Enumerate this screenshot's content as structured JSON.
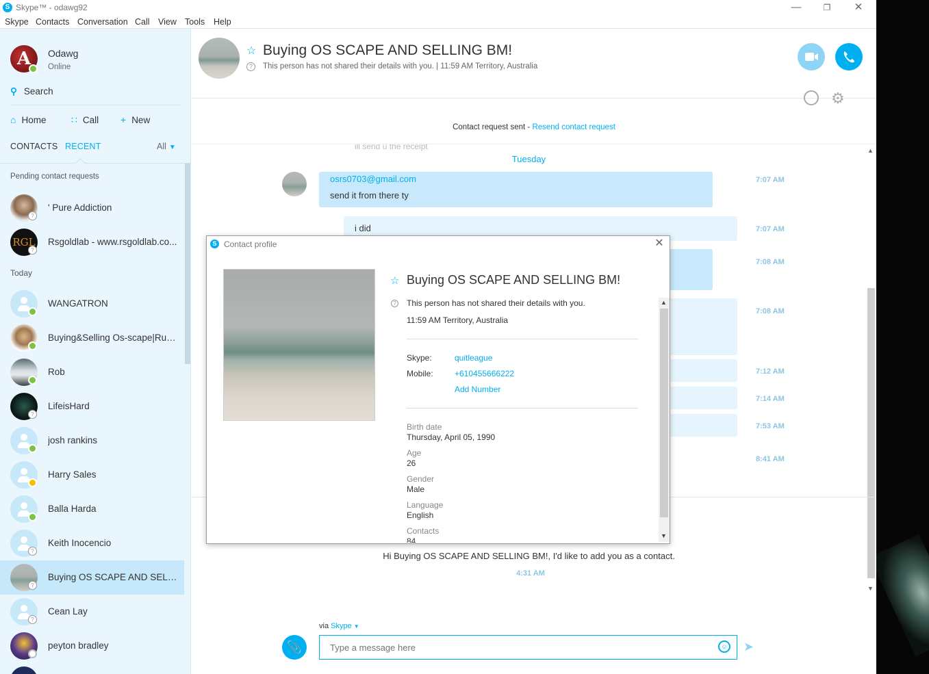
{
  "window": {
    "title": "Skype™ - odawg92",
    "logo": "S",
    "controls": {
      "minimize": "—",
      "restore": "❐",
      "close": "✕"
    }
  },
  "menu": [
    "Skype",
    "Contacts",
    "Conversation",
    "Call",
    "View",
    "Tools",
    "Help"
  ],
  "me": {
    "name": "Odawg",
    "status": "Online"
  },
  "sidebar": {
    "search": "Search",
    "nav": {
      "home": "Home",
      "call": "Call",
      "new": "New"
    },
    "tabs": {
      "contacts": "CONTACTS",
      "recent": "RECENT",
      "filter": "All"
    },
    "pending_label": "Pending contact requests",
    "pending": [
      {
        "name": "' Pure Addiction",
        "status": "unknown"
      },
      {
        "name": "Rsgoldlab - www.rsgoldlab.co...",
        "status": "unknown"
      }
    ],
    "today_label": "Today",
    "recent": [
      {
        "name": "WANGATRON",
        "status": "online"
      },
      {
        "name": "Buying&Selling Os-scape|Run...",
        "status": "online"
      },
      {
        "name": "Rob",
        "status": "online"
      },
      {
        "name": "LifeisHard",
        "status": "unknown"
      },
      {
        "name": "josh rankins",
        "status": "online"
      },
      {
        "name": "Harry  Sales",
        "status": "away"
      },
      {
        "name": "Balla Harda",
        "status": "online"
      },
      {
        "name": "Keith Inocencio",
        "status": "unknown"
      },
      {
        "name": "Buying OS SCAPE AND SELLIN...",
        "status": "unknown",
        "selected": true
      },
      {
        "name": "Cean Lay",
        "status": "unknown"
      },
      {
        "name": "peyton bradley",
        "status": "offline"
      }
    ]
  },
  "conversation": {
    "name": "Buying OS SCAPE AND SELLING BM!",
    "subtitle": "This person has not shared their details with you.  |  11:59 AM Territory, Australia",
    "request_text": "Contact request sent - ",
    "request_link": "Resend contact request",
    "faded_message": "ill send u the receipt",
    "day": "Tuesday",
    "messages": [
      {
        "line1": "osrs0703@gmail.com",
        "line2": "send it from there ty",
        "time": "7:07 AM"
      },
      {
        "text": "i did",
        "time": "7:07 AM"
      }
    ],
    "times": [
      "7:08 AM",
      "7:08 AM",
      "7:12 AM",
      "7:14 AM",
      "7:53 AM",
      "8:41 AM"
    ],
    "add_message": "Hi Buying OS SCAPE AND SELLING BM!, I'd like to add you as a contact.",
    "add_time": "4:31 AM"
  },
  "composer": {
    "via": "via",
    "via_service": "Skype",
    "placeholder": "Type a message here"
  },
  "dialog": {
    "title": "Contact profile",
    "name": "Buying OS SCAPE AND SELLING BM!",
    "notice": "This person has not shared their details with you.",
    "time_location": "11:59 AM Territory, Australia",
    "skype_label": "Skype:",
    "skype_value": "quitleague",
    "mobile_label": "Mobile:",
    "mobile_value": "+610455666222",
    "add_number": "Add Number",
    "fields": [
      {
        "label": "Birth date",
        "value": "Thursday, April 05, 1990"
      },
      {
        "label": "Age",
        "value": "26"
      },
      {
        "label": "Gender",
        "value": "Male"
      },
      {
        "label": "Language",
        "value": "English"
      },
      {
        "label": "Contacts",
        "value": "84"
      }
    ]
  },
  "colors": {
    "accent": "#00aff0",
    "sidebar_bg": "#e9f6fd",
    "bubble": "#c7e9fb",
    "online": "#7dc242",
    "away": "#f6c000"
  }
}
